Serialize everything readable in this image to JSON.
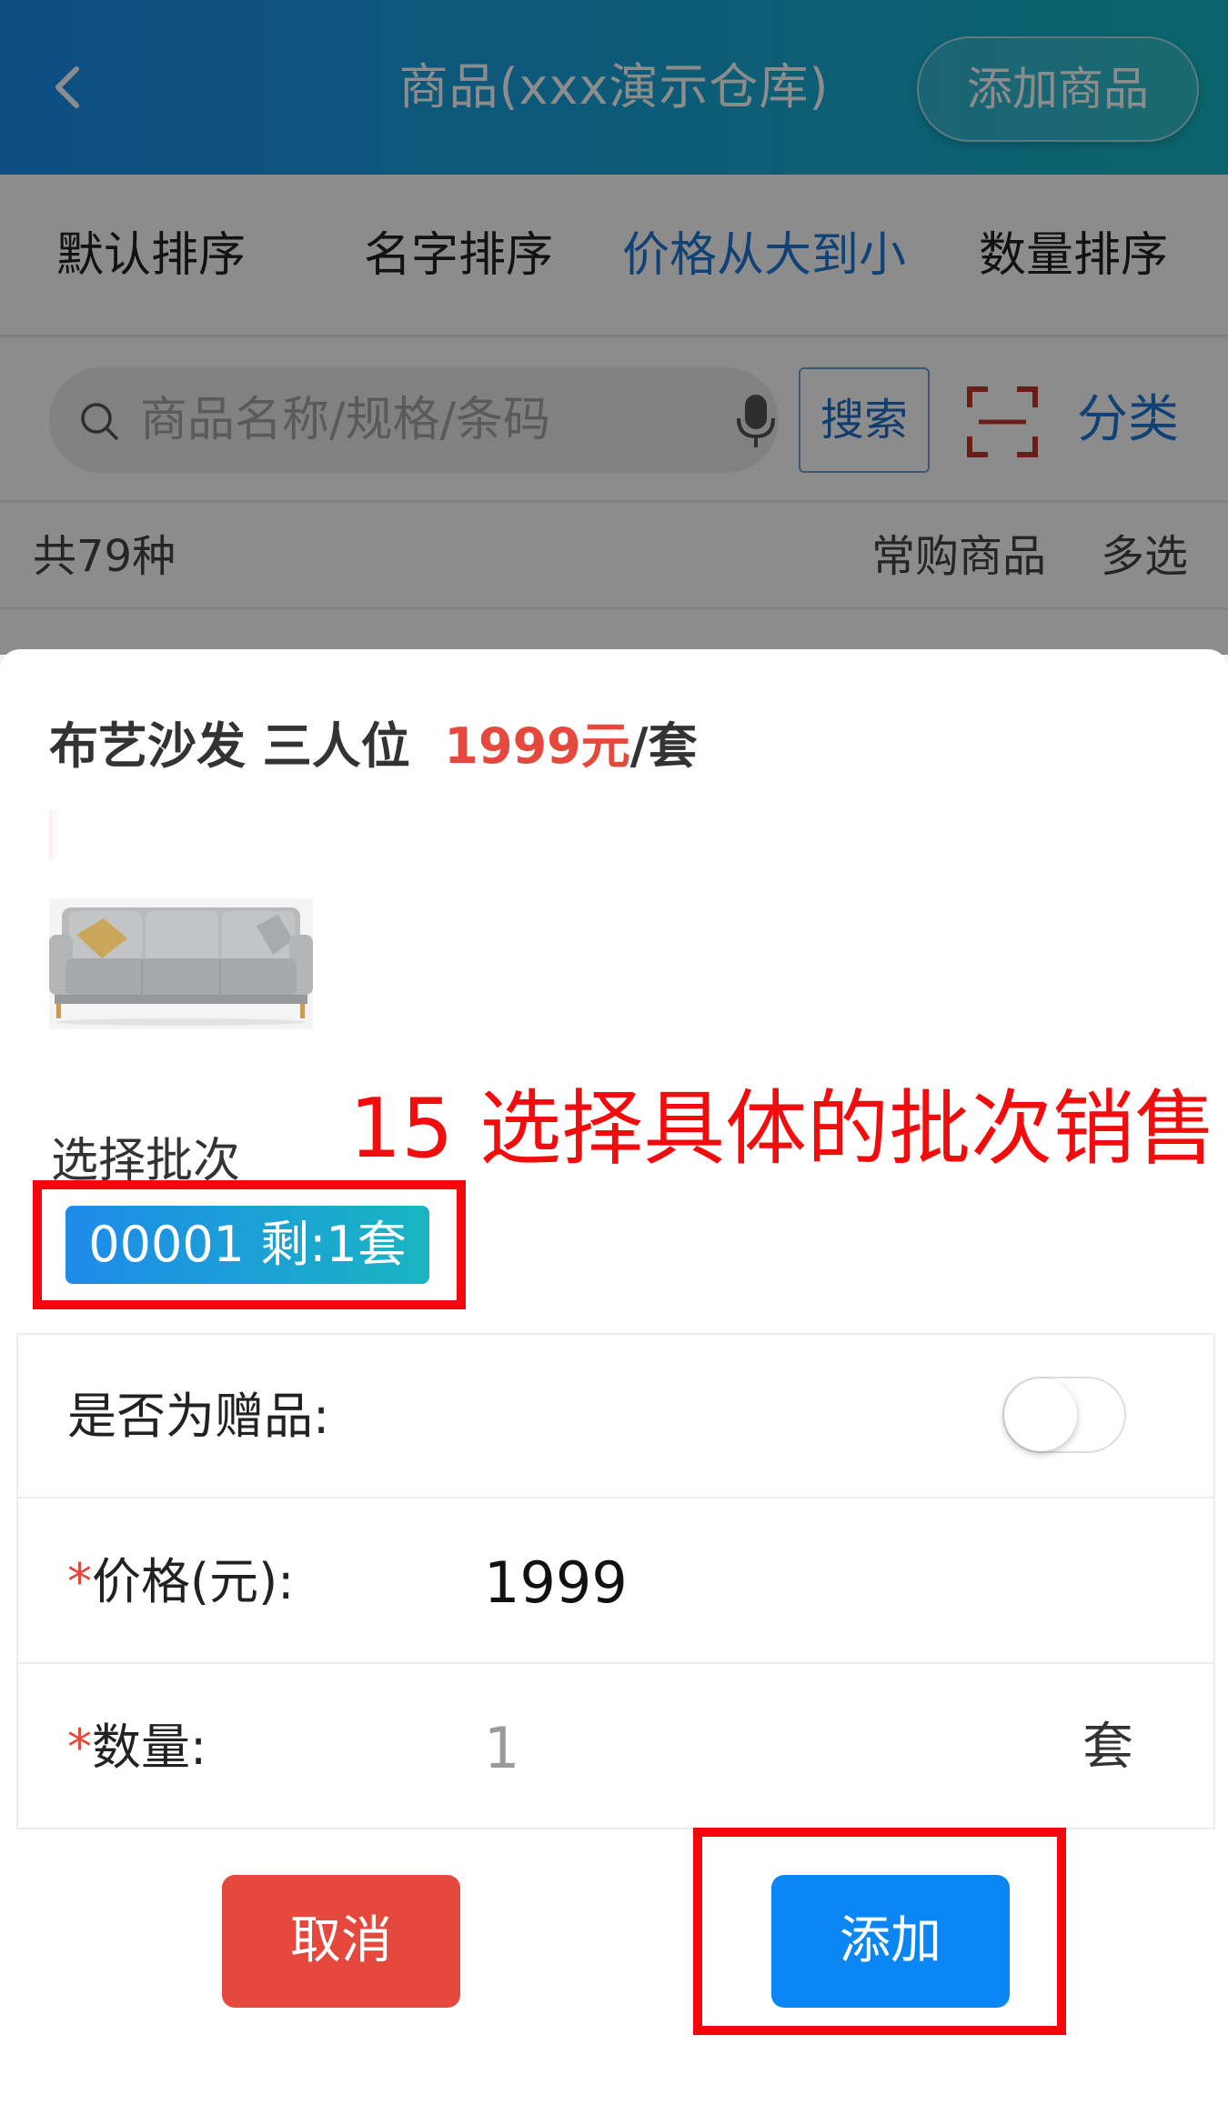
{
  "header": {
    "title": "商品(xxx演示仓库)",
    "add_goods_label": "添加商品"
  },
  "sort_bar": {
    "items": [
      {
        "label": "默认排序",
        "active": false
      },
      {
        "label": "名字排序",
        "active": false
      },
      {
        "label": "价格从大到小",
        "active": true
      },
      {
        "label": "数量排序",
        "active": false
      }
    ]
  },
  "search": {
    "placeholder": "商品名称/规格/条码",
    "button_label": "搜索",
    "category_label": "分类"
  },
  "list_info": {
    "count_text": "共79种",
    "frequent_label": "常购商品",
    "multi_select_label": "多选"
  },
  "dialog": {
    "product_name": "布艺沙发  三人位",
    "price": "1999元",
    "unit_suffix": "/套",
    "annotation": "15 选择具体的批次销售",
    "batch_label": "选择批次",
    "batch_option": "00001 剩:1套",
    "gift_label": "是否为赠品:",
    "gift_enabled": false,
    "price_label": "价格(元):",
    "price_value": "1999",
    "quantity_label": "数量:",
    "quantity_placeholder": "1",
    "quantity_unit": "套",
    "required_mark": "*",
    "cancel_label": "取消",
    "add_label": "添加"
  },
  "colors": {
    "header_gradient_start": "#1b8ff0",
    "header_gradient_end": "#14b7c4",
    "accent_blue": "#1f79d8",
    "price_red": "#e5493d",
    "cancel_red": "#e5493d",
    "add_blue": "#0a86f5",
    "annotation_red": "#f10d0d"
  },
  "icons": [
    "back-arrow-icon",
    "search-icon",
    "microphone-icon",
    "scan-icon"
  ]
}
